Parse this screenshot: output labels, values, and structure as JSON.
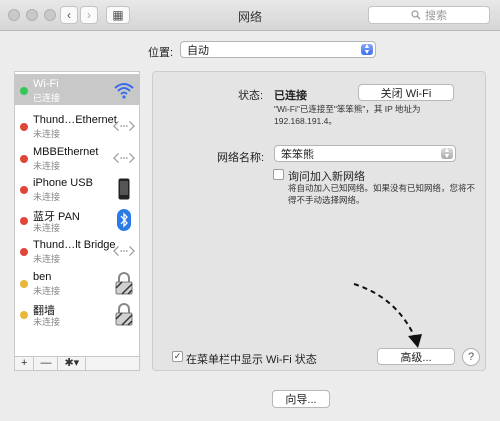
{
  "window": {
    "title": "网络"
  },
  "toolbar": {
    "back_glyph": "‹",
    "forward_glyph": "›",
    "grid_glyph": "▦"
  },
  "search": {
    "label": "搜索",
    "icon": "search-icon"
  },
  "location": {
    "label": "位置:",
    "value": "自动"
  },
  "networks": [
    {
      "name": "Wi-Fi",
      "status": "已连接",
      "dot": "#34c759",
      "icon": "wifi-icon",
      "selected": true
    },
    {
      "name": "Thund…Ethernet",
      "status": "未连接",
      "dot": "#e0453a",
      "icon": "ethernet-icon"
    },
    {
      "name": "MBBEthernet",
      "status": "未连接",
      "dot": "#e0453a",
      "icon": "ethernet-icon"
    },
    {
      "name": "iPhone USB",
      "status": "未连接",
      "dot": "#e0453a",
      "icon": "iphone-icon"
    },
    {
      "name": "蓝牙 PAN",
      "status": "未连接",
      "dot": "#e0453a",
      "icon": "bluetooth-icon"
    },
    {
      "name": "Thund…lt Bridge",
      "status": "未连接",
      "dot": "#e0453a",
      "icon": "ethernet-icon"
    },
    {
      "name": "ben",
      "status": "未连接",
      "dot": "#e8b73a",
      "icon": "lock-icon"
    },
    {
      "name": "翻墙",
      "status": "未连接",
      "dot": "#e8b73a",
      "icon": "lock-icon"
    }
  ],
  "sidebar_footer": {
    "add": "+",
    "remove": "—",
    "gear": "✱▾"
  },
  "status": {
    "label": "状态:",
    "value": "已连接",
    "turn_off_button": "关闭 Wi-Fi",
    "description_line1": "\"Wi-Fi\"已连接至\"笨笨熊\"，其 IP 地址为",
    "description_line2": "192.168.191.4。"
  },
  "network_name": {
    "label": "网络名称:",
    "value": "笨笨熊"
  },
  "ask_join": {
    "label": "询问加入新网络",
    "desc_line1": "将自动加入已知网络。如果没有已知网络，您将不",
    "desc_line2": "得不手动选择网络。",
    "checked": false
  },
  "show_menubar": {
    "label": "在菜单栏中显示 Wi-Fi 状态",
    "checked": true
  },
  "buttons": {
    "advanced": "高级...",
    "help": "?",
    "assist": "向导..."
  },
  "colors": {
    "accent": "#3a6ee8",
    "connected": "#34c759",
    "disconnected": "#e0453a",
    "inactive": "#e8b73a"
  }
}
